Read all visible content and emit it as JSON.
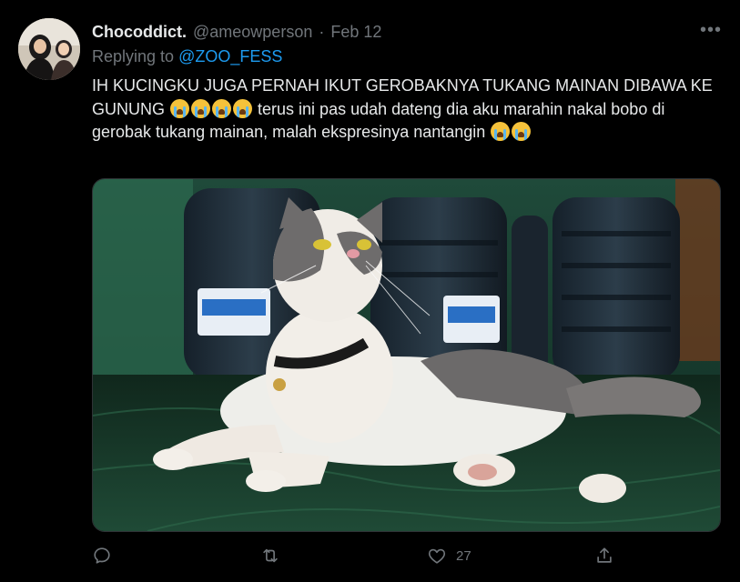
{
  "tweet": {
    "display_name": "Chocoddict.",
    "handle": "@ameowperson",
    "separator": "·",
    "date": "Feb 12",
    "reply_prefix": "Replying to",
    "reply_to": "@ZOO_FESS",
    "text_part1": "IH KUCINGKU JUGA PERNAH IKUT GEROBAKNYA TUKANG MAINAN DIBAWA KE GUNUNG",
    "text_part2": "terus ini pas udah dateng dia aku marahin nakal bobo di gerobak tukang mainan, malah ekspresinya nantangin",
    "emoji_name": "loudly-crying-face",
    "photo_subject": "cat",
    "more_label": "•••",
    "likes_count": "27"
  },
  "icons": {
    "reply": "reply-icon",
    "retweet": "retweet-icon",
    "like": "heart-icon",
    "share": "share-icon",
    "more": "more-icon"
  },
  "colors": {
    "background": "#000000",
    "primary_text": "#e7e9ea",
    "secondary_text": "#71767b",
    "link": "#1d9bf0"
  }
}
